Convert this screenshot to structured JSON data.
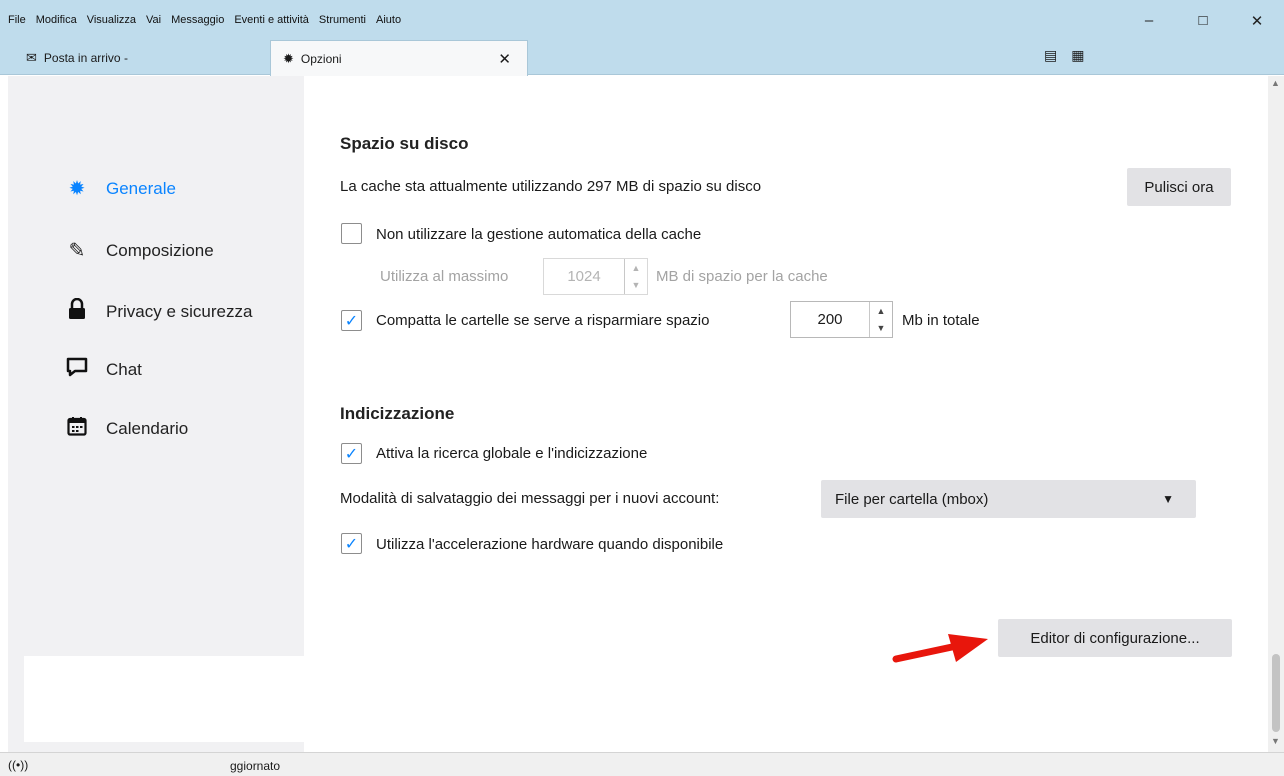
{
  "menu": [
    "File",
    "Modifica",
    "Visualizza",
    "Vai",
    "Messaggio",
    "Eventi e attività",
    "Strumenti",
    "Aiuto"
  ],
  "window_controls": {
    "minimize": "–",
    "maximize": "□",
    "close": "✕"
  },
  "tabs": [
    {
      "label": "Posta in arrivo -",
      "icon": "inbox-icon"
    },
    {
      "label": "Opzioni",
      "icon": "gear-icon",
      "close": "✕"
    }
  ],
  "sidebar": {
    "items": [
      {
        "label": "Generale",
        "icon": "gear-icon",
        "active": true
      },
      {
        "label": "Composizione",
        "icon": "pencil-icon"
      },
      {
        "label": "Privacy e sicurezza",
        "icon": "lock-icon"
      },
      {
        "label": "Chat",
        "icon": "chat-bubble-icon"
      },
      {
        "label": "Calendario",
        "icon": "calendar-icon"
      }
    ]
  },
  "disk": {
    "title": "Spazio su disco",
    "cache_text": "La cache sta attualmente utilizzando 297 MB di spazio su disco",
    "clear_button": "Pulisci ora",
    "no_auto_cache": {
      "label": "Non utilizzare la gestione automatica della cache",
      "checked": false
    },
    "max_use_label": "Utilizza al massimo",
    "max_use_value": "1024",
    "max_use_suffix": "MB di spazio per la cache",
    "compact": {
      "label": "Compatta le cartelle se serve a risparmiare spazio",
      "checked": true,
      "value": "200",
      "suffix": "Mb in totale"
    }
  },
  "indexing": {
    "title": "Indicizzazione",
    "global_search": {
      "label": "Attiva la ricerca globale e l'indicizzazione",
      "checked": true
    },
    "storage_label": "Modalità di salvataggio dei messaggi per i nuovi account:",
    "storage_value": "File per cartella (mbox)",
    "hw_accel": {
      "label": "Utilizza l'accelerazione hardware quando disponibile",
      "checked": true
    }
  },
  "config_editor_button": "Editor di configurazione...",
  "status": {
    "text": "ggiornato"
  },
  "colors": {
    "accent": "#0a84ff",
    "topbar": "#bfdcec",
    "arrow": "#e8160c"
  }
}
